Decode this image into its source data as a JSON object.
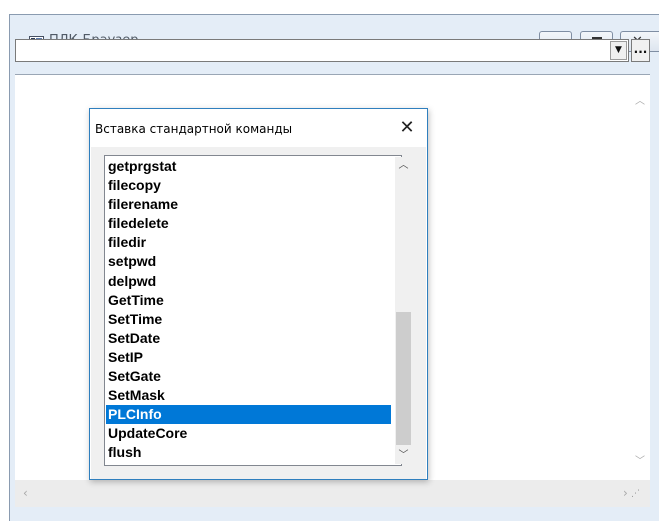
{
  "window": {
    "title": "ПЛК-Браузер",
    "close_glyph": "✕",
    "browse_label": "...",
    "address_value": ""
  },
  "dialog": {
    "title": "Вставка стандартной команды",
    "close_glyph": "✕",
    "items": [
      "getprgstat",
      "filecopy",
      "filerename",
      "filedelete",
      "filedir",
      "setpwd",
      "delpwd",
      "GetTime",
      "SetTime",
      "SetDate",
      "SetIP",
      "SetGate",
      "SetMask",
      "PLCInfo",
      "UpdateCore",
      "flush"
    ],
    "selected": "PLCInfo"
  },
  "icons": {
    "dropdown": "chevron-down-icon",
    "scroll_up": "chevron-up-icon",
    "scroll_down": "chevron-down-icon",
    "scroll_left": "chevron-left-icon",
    "scroll_right": "chevron-right-icon"
  },
  "colors": {
    "selection": "#0078d7",
    "dialog_border": "#2f7fbe",
    "window_frame": "#e4edf7"
  }
}
